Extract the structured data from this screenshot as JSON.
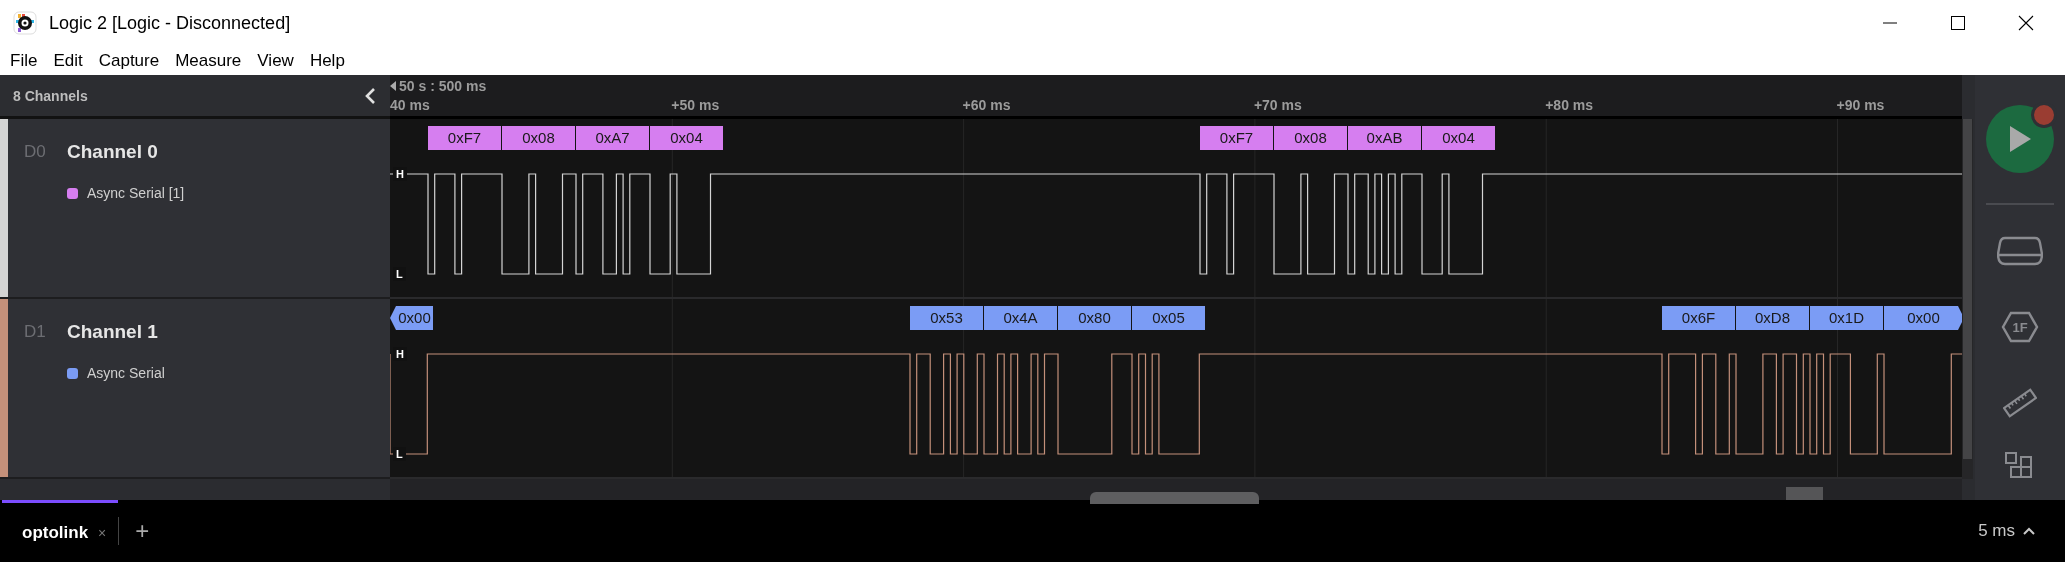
{
  "window": {
    "title": "Logic 2 [Logic - Disconnected]"
  },
  "menu": [
    "File",
    "Edit",
    "Capture",
    "Measure",
    "View",
    "Help"
  ],
  "channel_panel": {
    "title": "8 Channels"
  },
  "timeline": {
    "origin": "50 s : 500 ms",
    "ticks": [
      "40 ms",
      "+50 ms",
      "+60 ms",
      "+70 ms",
      "+80 ms",
      "+90 ms"
    ]
  },
  "channels": [
    {
      "id": "D0",
      "name": "Channel 0",
      "color": "#d4d4d4",
      "analyzer": {
        "name": "Async Serial [1]",
        "color": "#d67ef0"
      },
      "high_label": "H",
      "low_label": "L",
      "bursts": [
        {
          "frames": [
            {
              "value": "0xF7",
              "kind": "full"
            },
            {
              "value": "0x08",
              "kind": "full"
            },
            {
              "value": "0xA7",
              "kind": "full"
            },
            {
              "value": "0x04",
              "kind": "full"
            }
          ]
        },
        {
          "frames": [
            {
              "value": "0xF7",
              "kind": "full"
            },
            {
              "value": "0x08",
              "kind": "full"
            },
            {
              "value": "0xAB",
              "kind": "full"
            },
            {
              "value": "0x04",
              "kind": "full"
            }
          ]
        }
      ]
    },
    {
      "id": "D1",
      "name": "Channel 1",
      "color": "#c4907a",
      "analyzer": {
        "name": "Async Serial",
        "color": "#7b9cf5"
      },
      "high_label": "H",
      "low_label": "L",
      "bursts": [
        {
          "frames": [
            {
              "value": "0x00",
              "kind": "cut-left"
            }
          ]
        },
        {
          "frames": [
            {
              "value": "0x53",
              "kind": "full"
            },
            {
              "value": "0x4A",
              "kind": "full"
            },
            {
              "value": "0x80",
              "kind": "full"
            },
            {
              "value": "0x05",
              "kind": "full"
            }
          ]
        },
        {
          "frames": [
            {
              "value": "0x6F",
              "kind": "full"
            },
            {
              "value": "0xD8",
              "kind": "full"
            },
            {
              "value": "0x1D",
              "kind": "full"
            },
            {
              "value": "0x00",
              "kind": "cut-right"
            }
          ]
        }
      ]
    }
  ],
  "sidebar": {
    "analyzers_label": "1F"
  },
  "tabs": [
    {
      "label": "optolink",
      "selected": true,
      "close": "×"
    }
  ],
  "new_tab": "+",
  "timescale": "5 ms"
}
